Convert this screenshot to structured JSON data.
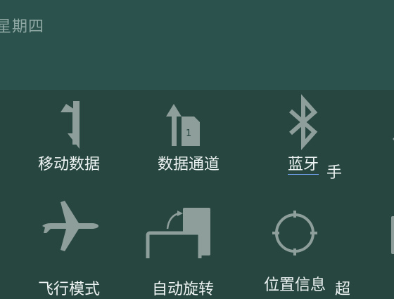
{
  "status": {
    "date": "星期四"
  },
  "quick_settings": {
    "tiles": [
      {
        "label": "移动数据",
        "icon": "data-arrows-icon"
      },
      {
        "label": "数据通道",
        "icon": "sim-card-icon"
      },
      {
        "label": "蓝牙",
        "icon": "bluetooth-icon"
      },
      {
        "label": "手",
        "icon": "flashlight-icon"
      },
      {
        "label": "飞行模式",
        "icon": "airplane-icon"
      },
      {
        "label": "自动旋转",
        "icon": "auto-rotate-icon"
      },
      {
        "label": "位置信息",
        "icon": "location-icon"
      },
      {
        "label": "超",
        "icon": "power-saving-icon"
      }
    ]
  }
}
